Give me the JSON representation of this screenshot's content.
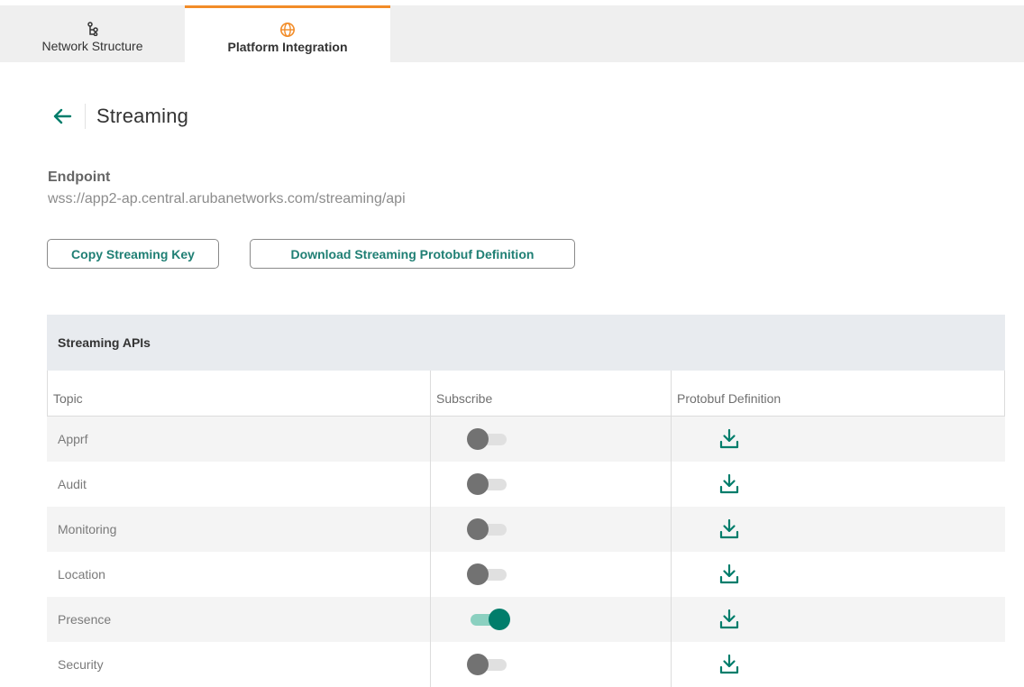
{
  "tabs": [
    {
      "label": "Network Structure",
      "icon": "hierarchy-icon",
      "active": false
    },
    {
      "label": "Platform Integration",
      "icon": "globe-icon",
      "active": true
    }
  ],
  "page": {
    "title": "Streaming",
    "back_icon": "arrow-left-icon"
  },
  "endpoint": {
    "label": "Endpoint",
    "value": "wss://app2-ap.central.arubanetworks.com/streaming/api"
  },
  "buttons": {
    "copy_key": "Copy Streaming Key",
    "download_proto": "Download Streaming Protobuf Definition"
  },
  "table": {
    "title": "Streaming APIs",
    "columns": [
      "Topic",
      "Subscribe",
      "Protobuf Definition"
    ],
    "rows": [
      {
        "topic": "Apprf",
        "subscribed": false
      },
      {
        "topic": "Audit",
        "subscribed": false
      },
      {
        "topic": "Monitoring",
        "subscribed": false
      },
      {
        "topic": "Location",
        "subscribed": false
      },
      {
        "topic": "Presence",
        "subscribed": true
      },
      {
        "topic": "Security",
        "subscribed": false
      }
    ]
  },
  "colors": {
    "accent": "#f28c28",
    "brand_teal": "#017d6b",
    "toggle_on_track": "#8bd0c0",
    "toggle_off_knob": "#727272"
  }
}
